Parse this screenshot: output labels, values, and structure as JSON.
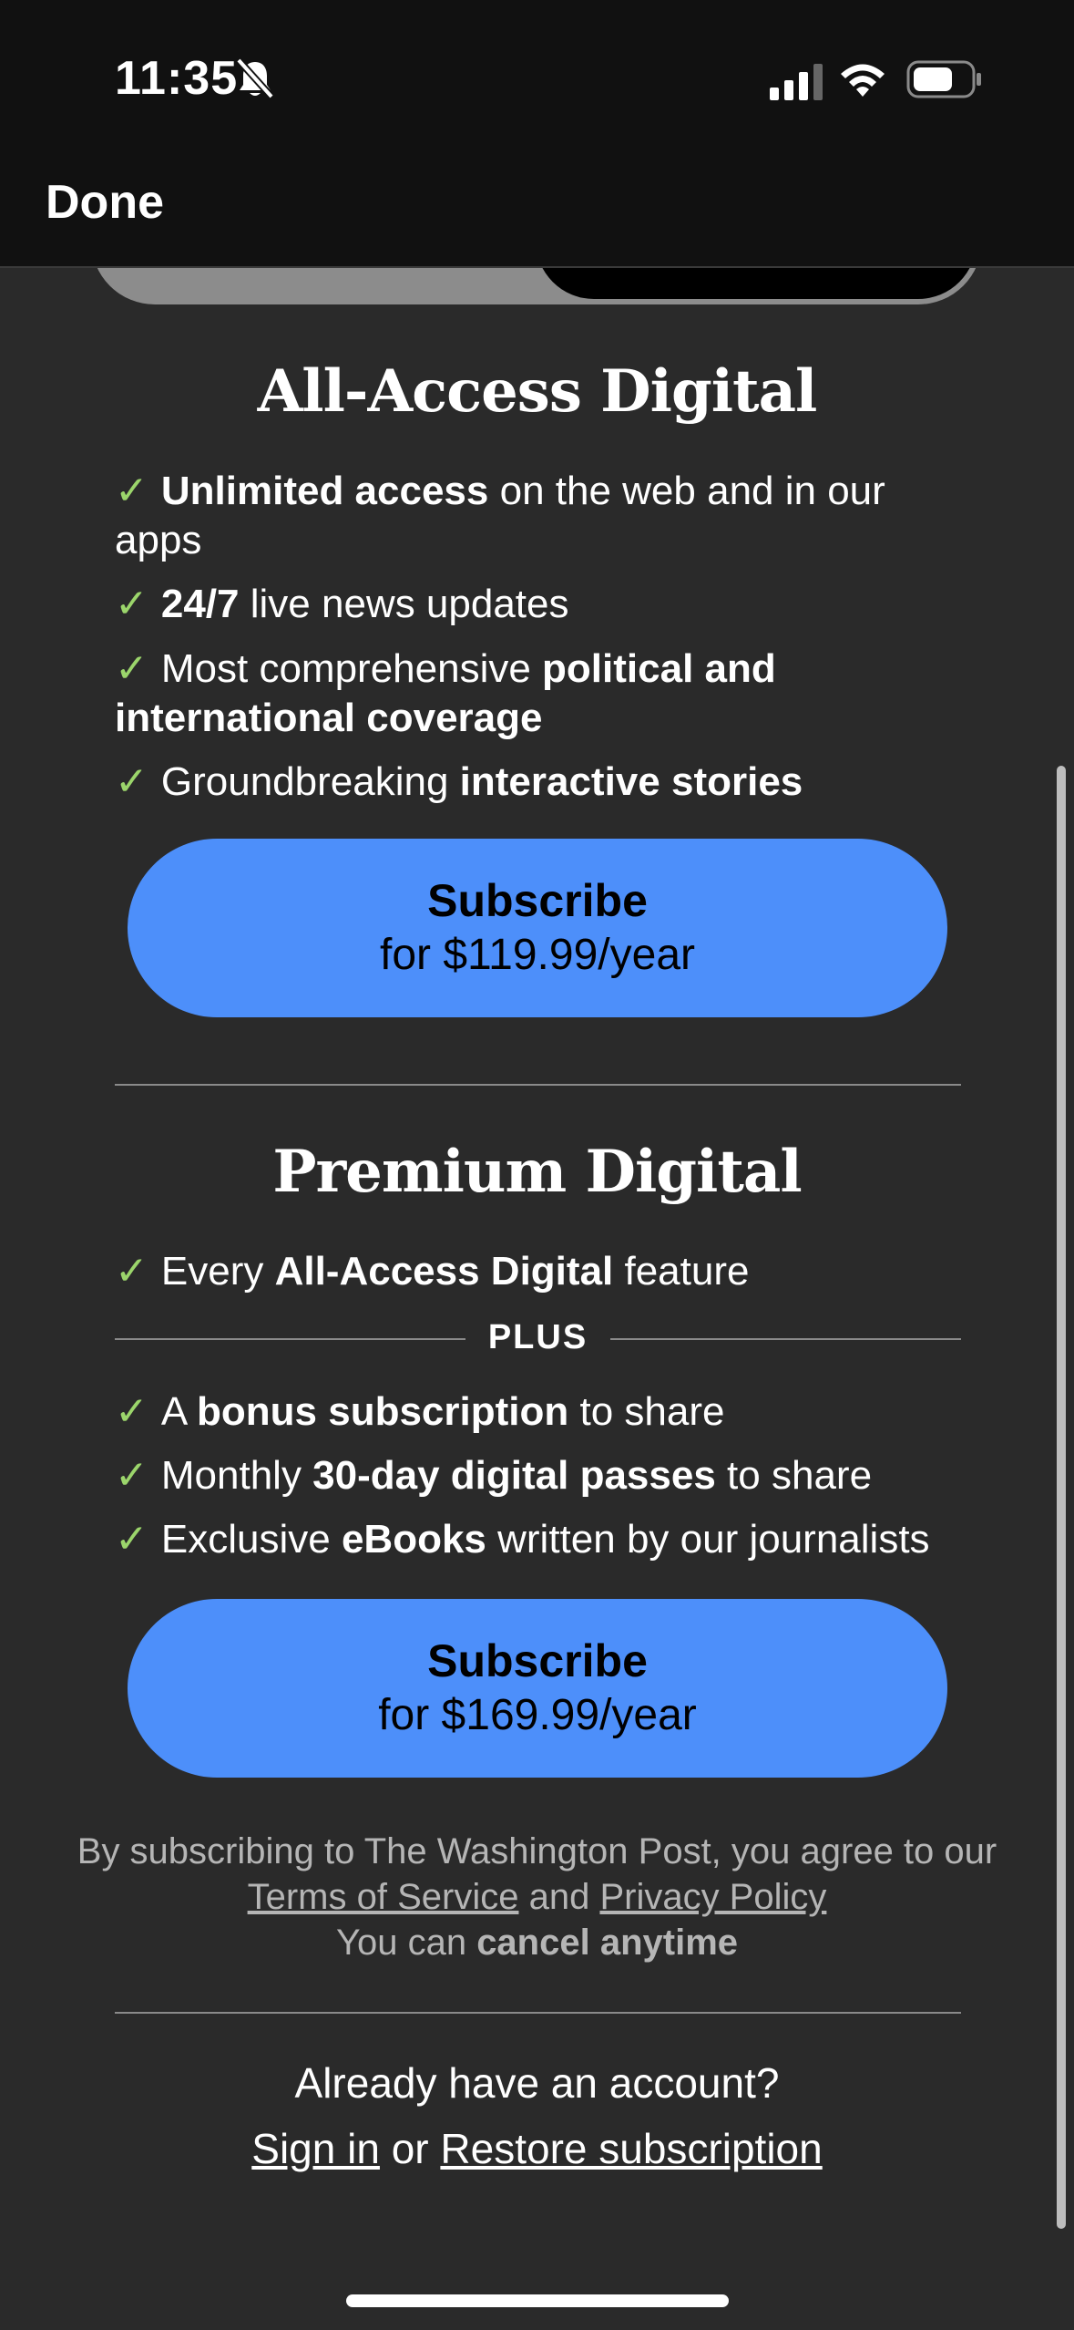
{
  "status_bar": {
    "time": "11:35",
    "icons": [
      "bell-slash-icon",
      "signal-icon",
      "wifi-icon",
      "battery-icon"
    ]
  },
  "nav": {
    "done_label": "Done"
  },
  "plans": [
    {
      "title": "All-Access Digital",
      "features": [
        {
          "bold": "Unlimited access",
          "rest": " on the web and in our apps"
        },
        {
          "bold": "24/7",
          "rest": " live news updates"
        },
        {
          "pre": "Most comprehensive ",
          "bold": "political and international coverage"
        },
        {
          "pre": "Groundbreaking ",
          "bold": "interactive stories"
        }
      ],
      "button": {
        "label": "Subscribe",
        "price": "for $119.99/year"
      }
    },
    {
      "title": "Premium Digital",
      "features": [
        {
          "pre": "Every ",
          "bold": "All-Access Digital",
          "rest": " feature"
        }
      ],
      "plus_label": "PLUS",
      "extra_features": [
        {
          "pre": "A ",
          "bold": "bonus subscription",
          "rest": " to share"
        },
        {
          "pre": "Monthly ",
          "bold": "30-day digital passes",
          "rest": " to share"
        },
        {
          "pre": "Exclusive ",
          "bold": "eBooks",
          "rest": " written by our journalists"
        }
      ],
      "button": {
        "label": "Subscribe",
        "price": "for $169.99/year"
      }
    }
  ],
  "legal": {
    "prefix": "By subscribing to The Washington Post, you agree to our ",
    "terms_link": "Terms of Service",
    "and": " and ",
    "privacy_link": "Privacy Policy",
    "cancel_pre": "You can ",
    "cancel_bold": "cancel anytime"
  },
  "account": {
    "question": "Already have an account?",
    "sign_in": "Sign in",
    "or": " or ",
    "restore": "Restore subscription"
  },
  "colors": {
    "background": "#2a2a2a",
    "topbar": "#111111",
    "button": "#4d8ffa",
    "check": "#9bd56b"
  }
}
